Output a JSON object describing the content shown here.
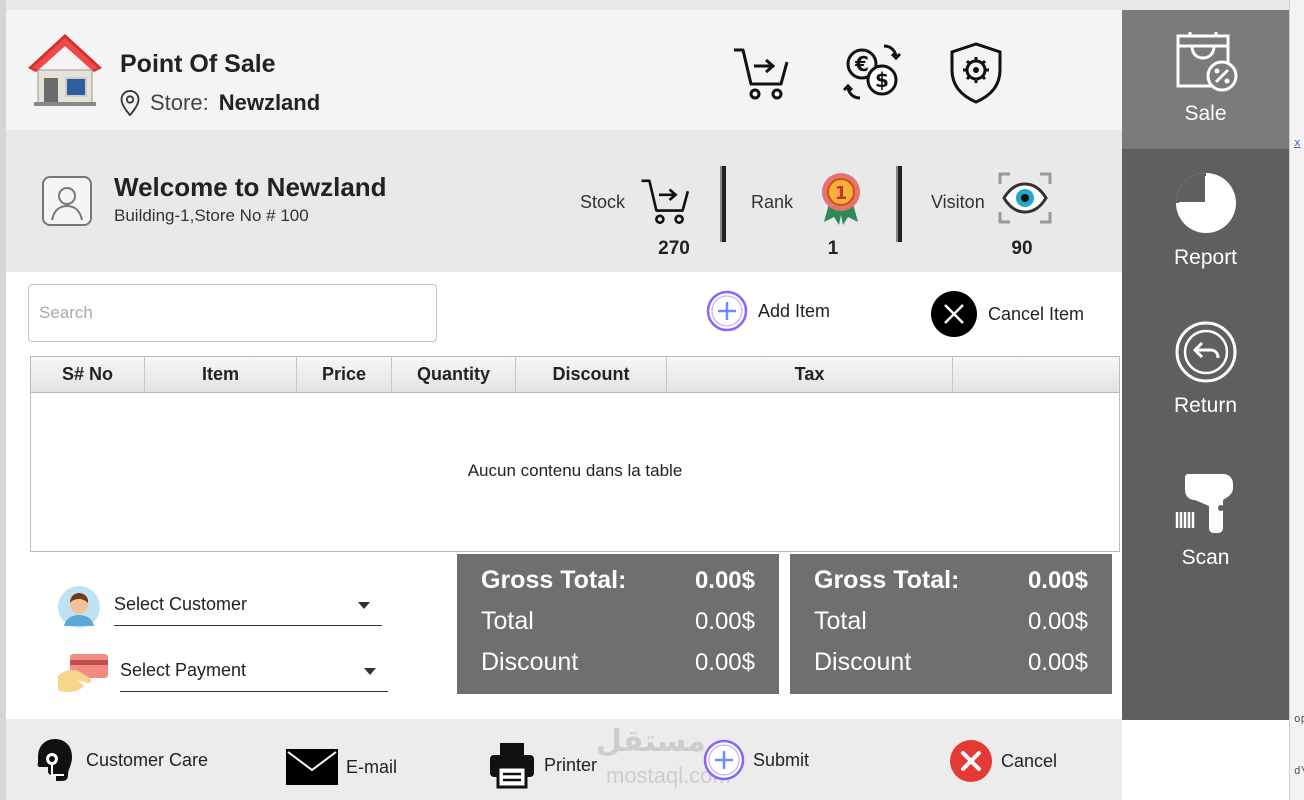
{
  "header": {
    "title": "Point Of Sale",
    "store_label": "Store:",
    "store_name": "Newzland"
  },
  "welcome": {
    "title": "Welcome to Newzland",
    "subtitle": "Building-1,Store No # 100",
    "stats": [
      {
        "label": "Stock",
        "value": "270"
      },
      {
        "label": "Rank",
        "value": "1"
      },
      {
        "label": "Visiton",
        "value": "90"
      }
    ]
  },
  "search": {
    "placeholder": "Search"
  },
  "actions": {
    "add_item": "Add Item",
    "cancel_item": "Cancel Item"
  },
  "table": {
    "columns": [
      "S# No",
      "Item",
      "Price",
      "Quantity",
      "Discount",
      "Tax",
      ""
    ],
    "empty_message": "Aucun contenu dans la table"
  },
  "selectors": {
    "customer": "Select Customer",
    "payment": "Select Payment"
  },
  "totals": [
    {
      "gross_label": "Gross Total:",
      "gross_value": "0.00$",
      "total_label": "Total",
      "total_value": "0.00$",
      "discount_label": "Discount",
      "discount_value": "0.00$"
    },
    {
      "gross_label": "Gross Total:",
      "gross_value": "0.00$",
      "total_label": "Total",
      "total_value": "0.00$",
      "discount_label": "Discount",
      "discount_value": "0.00$"
    }
  ],
  "footer": {
    "customer_care": "Customer Care",
    "email": "E-mail",
    "printer": "Printer",
    "submit": "Submit",
    "cancel": "Cancel",
    "watermark": "مستقل",
    "watermark_latin": "mostaql.com"
  },
  "sidebar": {
    "items": [
      {
        "label": "Sale",
        "icon": "sale-bag-icon"
      },
      {
        "label": "Report",
        "icon": "pie-chart-icon"
      },
      {
        "label": "Return",
        "icon": "return-icon"
      },
      {
        "label": "Scan",
        "icon": "barcode-scanner-icon"
      }
    ]
  },
  "background_fragments": [
    "x",
    "op",
    "d\\"
  ],
  "colors": {
    "sidebar": "#5f5f5f",
    "sidebar_active": "#7b7b7b",
    "totals_panel": "#6f6f6f",
    "cancel_red": "#e53935",
    "add_purple": "#7c5cff"
  }
}
